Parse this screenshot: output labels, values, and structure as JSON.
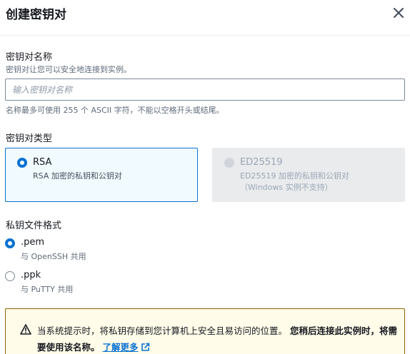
{
  "dialog": {
    "title": "创建密钥对"
  },
  "key_name": {
    "label": "密钥对名称",
    "description": "密钥对让您可以安全地连接到实例。",
    "placeholder": "输入密钥对名称",
    "value": "",
    "constraint": "名称最多可使用 255 个 ASCII 字符，不能以空格开头或结尾。"
  },
  "key_type": {
    "label": "密钥对类型",
    "options": [
      {
        "title": "RSA",
        "description": "RSA 加密的私钥和公钥对",
        "note": "",
        "selected": true,
        "disabled": false
      },
      {
        "title": "ED25519",
        "description": "ED25519 加密的私钥和公钥对",
        "note": "（Windows 实例不支持）",
        "selected": false,
        "disabled": true
      }
    ]
  },
  "file_format": {
    "label": "私钥文件格式",
    "options": [
      {
        "title": ".pem",
        "description": "与 OpenSSH 共用",
        "selected": true
      },
      {
        "title": ".ppk",
        "description": "与 PuTTY 共用",
        "selected": false
      }
    ]
  },
  "alert": {
    "text": "当系统提示时，将私钥存储到您计算机上安全且易访问的位置。",
    "bold_text": "您稍后连接此实例时，将需要使用该名称。",
    "link_text": "了解更多"
  },
  "icons": [
    "close-icon",
    "warning-icon",
    "external-link-icon"
  ],
  "colors": {
    "primary": "#0972d3",
    "warning_border": "#8d6605",
    "warning_bg": "#fffce9"
  }
}
